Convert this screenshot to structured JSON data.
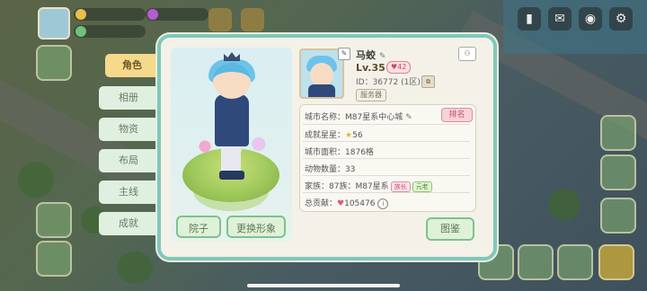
{
  "tabs": [
    {
      "label": "角色",
      "active": true
    },
    {
      "label": "相册",
      "active": false
    },
    {
      "label": "物资",
      "active": false
    },
    {
      "label": "布局",
      "active": false
    },
    {
      "label": "主线",
      "active": false
    },
    {
      "label": "成就",
      "active": false
    }
  ],
  "character": {
    "yard_button": "院子",
    "change_look_button": "更换形象"
  },
  "profile": {
    "name": "马蛟",
    "level": "Lv.35",
    "hearts": "42",
    "id_text": "ID：36772 (1区)",
    "server_tag": "服务器"
  },
  "info": {
    "city_name_label": "城市名称：",
    "city_name_value": "M87星系中心城",
    "rank_button": "排名",
    "stars_label": "成就星星：",
    "stars_value": "56",
    "area_label": "城市面积：",
    "area_value": "1876格",
    "animals_label": "动物数量：",
    "animals_value": "33",
    "family_label": "家族：",
    "family_value": "87族：M87星系",
    "family_tag_leader": "族长",
    "family_tag_elder": "元老",
    "contribution_label": "总贡献：",
    "contribution_value": "105476"
  },
  "handbook_button": "图鉴",
  "colors": {
    "panel_border": "#7fc8b8",
    "active_tab": "#f6d98a",
    "green_button": "#7cc38a",
    "rank_pink": "#e08ba0"
  }
}
